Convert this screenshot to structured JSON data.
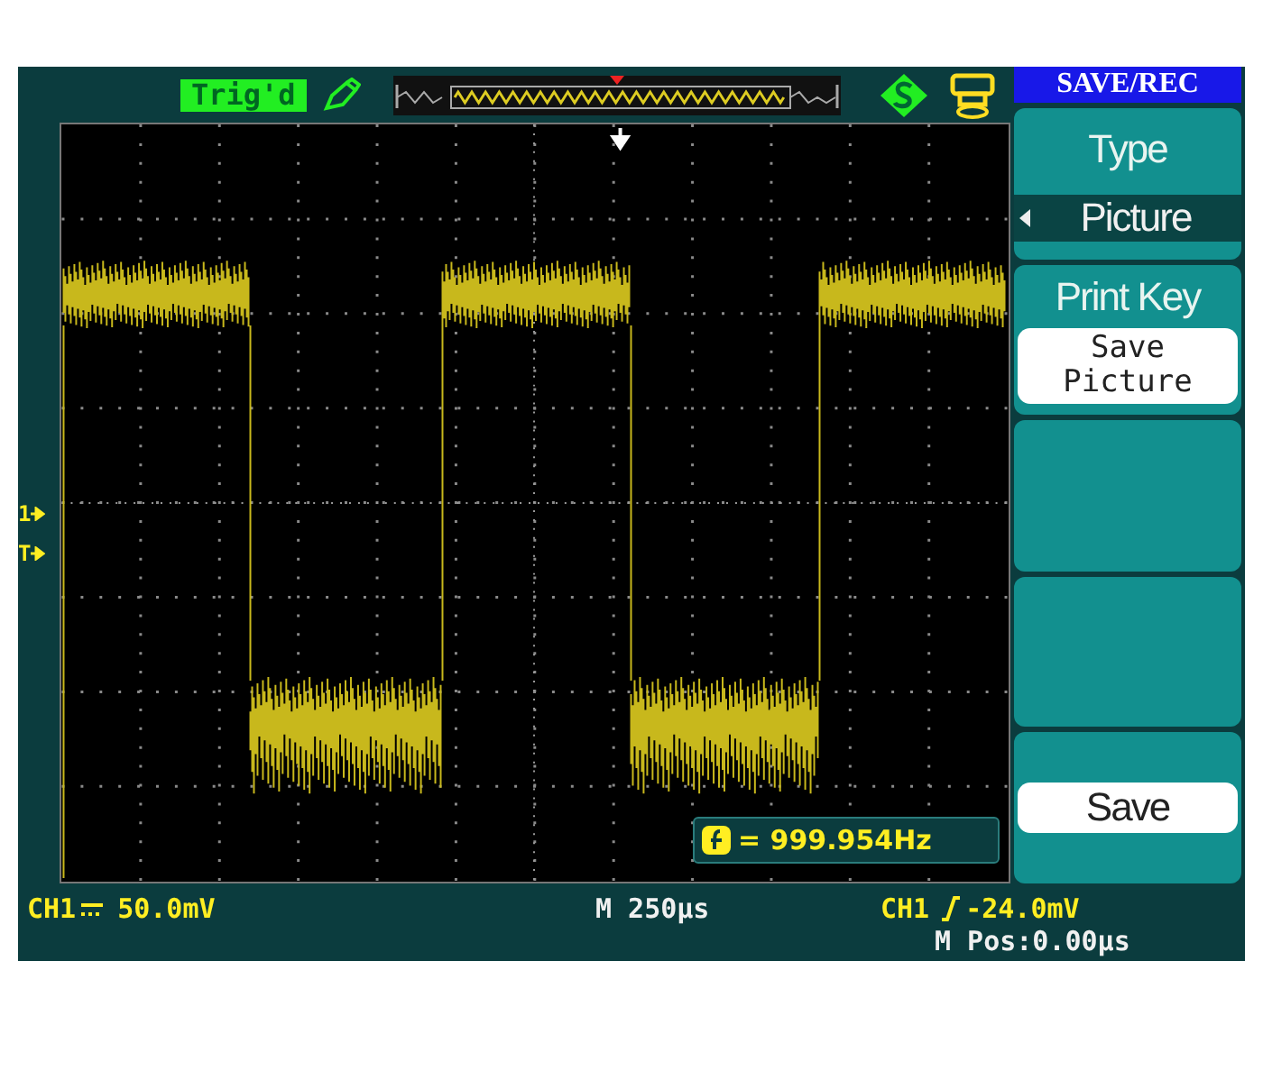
{
  "top_bar": {
    "trigger_status": "Trig'd"
  },
  "menu": {
    "title": "SAVE/REC",
    "items": [
      {
        "kind": "select",
        "label": "Type",
        "value": "Picture"
      },
      {
        "kind": "option",
        "label": "Print Key",
        "value": "Save Picture"
      },
      {
        "kind": "empty"
      },
      {
        "kind": "empty"
      },
      {
        "kind": "button",
        "label": "Save"
      }
    ]
  },
  "markers": [
    {
      "label": "1"
    },
    {
      "label": "T"
    }
  ],
  "frequency": "= 999.954Hz",
  "status_bar": {
    "channel": "CH1",
    "scale": "50.0mV",
    "timebase": "M 250μs",
    "trigger_source": "CH1",
    "trigger_level": "-24.0mV",
    "position": "M Pos:0.00μs"
  }
}
